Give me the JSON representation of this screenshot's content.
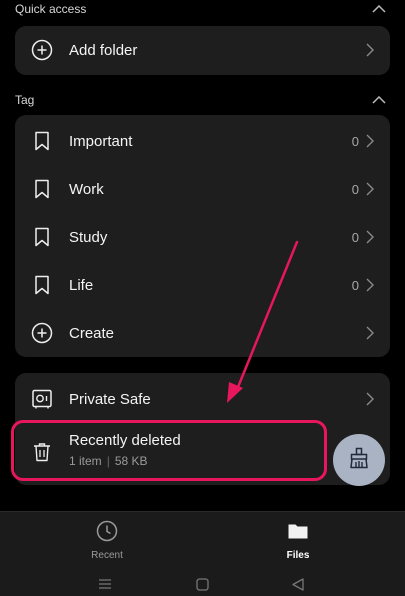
{
  "quick_access": {
    "header": "Quick access",
    "items": [
      {
        "label": "Add folder",
        "icon": "plus-circle-icon"
      }
    ]
  },
  "tag": {
    "header": "Tag",
    "items": [
      {
        "label": "Important",
        "count": "0",
        "icon": "bookmark-icon"
      },
      {
        "label": "Work",
        "count": "0",
        "icon": "bookmark-icon"
      },
      {
        "label": "Study",
        "count": "0",
        "icon": "bookmark-icon"
      },
      {
        "label": "Life",
        "count": "0",
        "icon": "bookmark-icon"
      },
      {
        "label": "Create",
        "icon": "plus-circle-icon"
      }
    ]
  },
  "other": {
    "private_safe": {
      "label": "Private Safe",
      "icon": "safe-icon"
    },
    "recently_deleted": {
      "label": "Recently deleted",
      "items_count": "1 item",
      "separator": "|",
      "size": "58 KB",
      "icon": "trash-icon"
    }
  },
  "fab": {
    "icon": "broom-clean-icon"
  },
  "bottom_nav": {
    "tabs": [
      {
        "label": "Recent",
        "icon": "clock-icon",
        "active": false
      },
      {
        "label": "Files",
        "icon": "folder-icon",
        "active": true
      }
    ]
  },
  "colors": {
    "background": "#000000",
    "card": "#1e1e1f",
    "highlight": "#e8175d",
    "fab": "#aab3c3"
  }
}
